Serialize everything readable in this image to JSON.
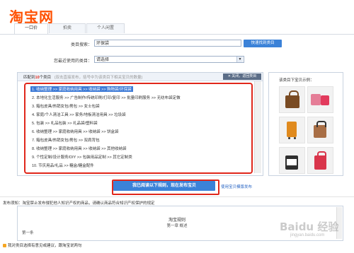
{
  "logo_text": "淘宝网",
  "tabs": [
    {
      "label": "一口价"
    },
    {
      "label": "拍卖"
    },
    {
      "label": "个人闲置"
    }
  ],
  "search": {
    "label": "类目搜索：",
    "value": "环保袋",
    "button": "快速找到类目"
  },
  "recent": {
    "label": "您最近使用的类目：",
    "value": "请选择"
  },
  "results": {
    "prefix": "匹配到",
    "count": "10",
    "suffix": "个类目",
    "hint": "(双击直接发布，括号中为该类目下相关宝贝的数量)",
    "close_label": "✕ 关闭，返回类目",
    "items": [
      "1.  收纳整理 >> 家庭收纳用具 >> 收纳袋 >> 购物袋/环保袋",
      "2.  本地化生活服务 >> 广告制作/传统印刷/打印/复印 >> 批量印刷服务 >> 无纺布袋定做",
      "3.  箱包皮具/热销女包/男包 >> 女士包袋",
      "4.  家庭/个人清洁工具 >> 家务/地板清洁用具 >> 垃圾袋",
      "5.  包装 >> 礼品包装 >> 礼品袋/塑料袋",
      "6.  收纳整理 >> 家庭收纳用具 >> 收纳袋 >> 饼盒袋",
      "7.  箱包皮具/热销女包/男包 >> 双肩背包",
      "8.  收纳整理 >> 家庭收纳用具 >> 收纳袋 >> 其他收纳袋",
      "9.  个性定制/设计服务/DIY >> 包装用品定制 >> 其它定制类",
      "10.  节庆用品/礼品 >> 糖盒/糖盒配件"
    ]
  },
  "preview": {
    "title": "该类目下宝贝示例："
  },
  "publish": {
    "button": "我已阅读以下规则，现在发布宝贝",
    "alt_link": "使用宝贝模版发布"
  },
  "notice": {
    "label": "发布须知：",
    "text": "淘宝禁止发布侵犯他人知识产权的商品，请确认商品符合知识产权保护的规定",
    "rules_title": "淘宝规则",
    "rules_chapter": "第一章  概述",
    "rules_section": "第一条"
  },
  "footer": {
    "recommend": "我对类目选择有意见或建议，跟淘宝说两句"
  },
  "watermark": "Baidu 经验",
  "watermark_url": "jingyan.baidu.com",
  "colors": {
    "brand": "#ff5000",
    "accent_blue": "#3b82d8",
    "highlight": "#e0271b"
  }
}
